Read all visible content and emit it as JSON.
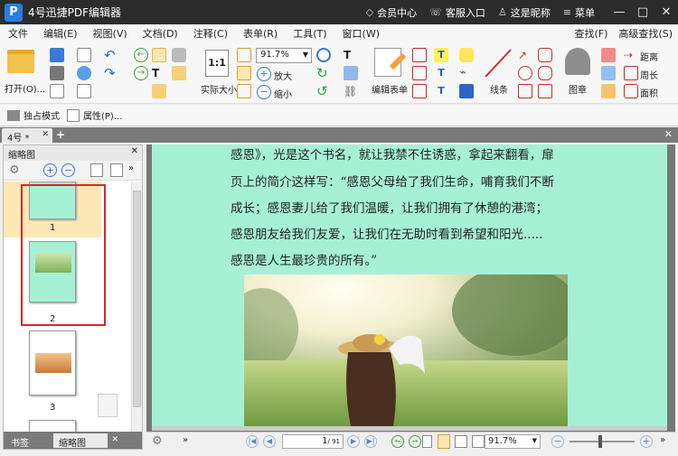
{
  "app": {
    "title": "4号迅捷PDF编辑器",
    "logo_letter": "P"
  },
  "titlebar": {
    "items": [
      "会员中心",
      "客服入口",
      "这是昵称",
      "菜单"
    ],
    "minimize": "—",
    "maximize": "□",
    "close": "✕"
  },
  "menu": [
    "文件",
    "编辑(E)",
    "视图(V)",
    "文档(D)",
    "注释(C)",
    "表单(R)",
    "工具(T)",
    "窗口(W)"
  ],
  "menu_right": [
    "查找(F)",
    "高级查找(S)"
  ],
  "ribbon": {
    "open_label": "打开(O)...",
    "actual_size_label": "实际大小",
    "zoom_value": "91.7%",
    "zoom_in_label": "放大",
    "zoom_out_label": "缩小",
    "edit_form_label": "编辑表单",
    "line_label": "线条",
    "stamp_label": "图章",
    "distance_label": "距离",
    "perimeter_label": "周长",
    "area_label": "面积"
  },
  "toolbar2": {
    "exclusive_mode": "独占模式",
    "properties": "属性(P)..."
  },
  "tabs": {
    "doc_tab": "4号 *",
    "close": "✕",
    "add": "+",
    "bar_close": "✕"
  },
  "thumbnail_panel": {
    "title": "缩略图",
    "close": "✕",
    "pages": [
      "1",
      "2",
      "3"
    ],
    "tabs": [
      "书签",
      "缩略图"
    ],
    "tab_close": "✕"
  },
  "document": {
    "lines": [
      "感恩》，光是这个书名，就让我禁不住诱惑，拿起来翻看，扉",
      "页上的简介这样写：“感恩父母给了我们生命，哺育我们不断",
      "成长；感恩妻儿给了我们温暖，让我们拥有了休憩的港湾；",
      "感恩朋友给我们友爱，让我们在无助时看到希望和阳光.....",
      "感恩是人生最珍贵的所有。”"
    ]
  },
  "status": {
    "page_input": "1",
    "page_total": "/ 91",
    "zoom": "91.7%",
    "zoom_minus": "−",
    "zoom_plus": "+"
  },
  "colors": {
    "page_bg": "#a6f1d6",
    "titlebar": "#2c2c2c",
    "highlight_box": "#e0242c",
    "selected_thumb": "#fbe8b5"
  }
}
